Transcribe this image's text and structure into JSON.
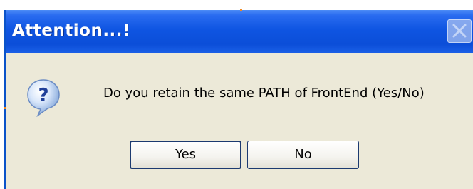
{
  "window": {
    "title": "Attention...!",
    "close_icon": "close-icon"
  },
  "content": {
    "icon": "question-icon",
    "message": "Do you retain the same PATH of FrontEnd (Yes/No)"
  },
  "buttons": {
    "yes_label": "Yes",
    "no_label": "No"
  },
  "colors": {
    "titlebar": "#0b4ed8",
    "dialog_background": "#ece9d8",
    "button_border": "#1c3a70"
  }
}
